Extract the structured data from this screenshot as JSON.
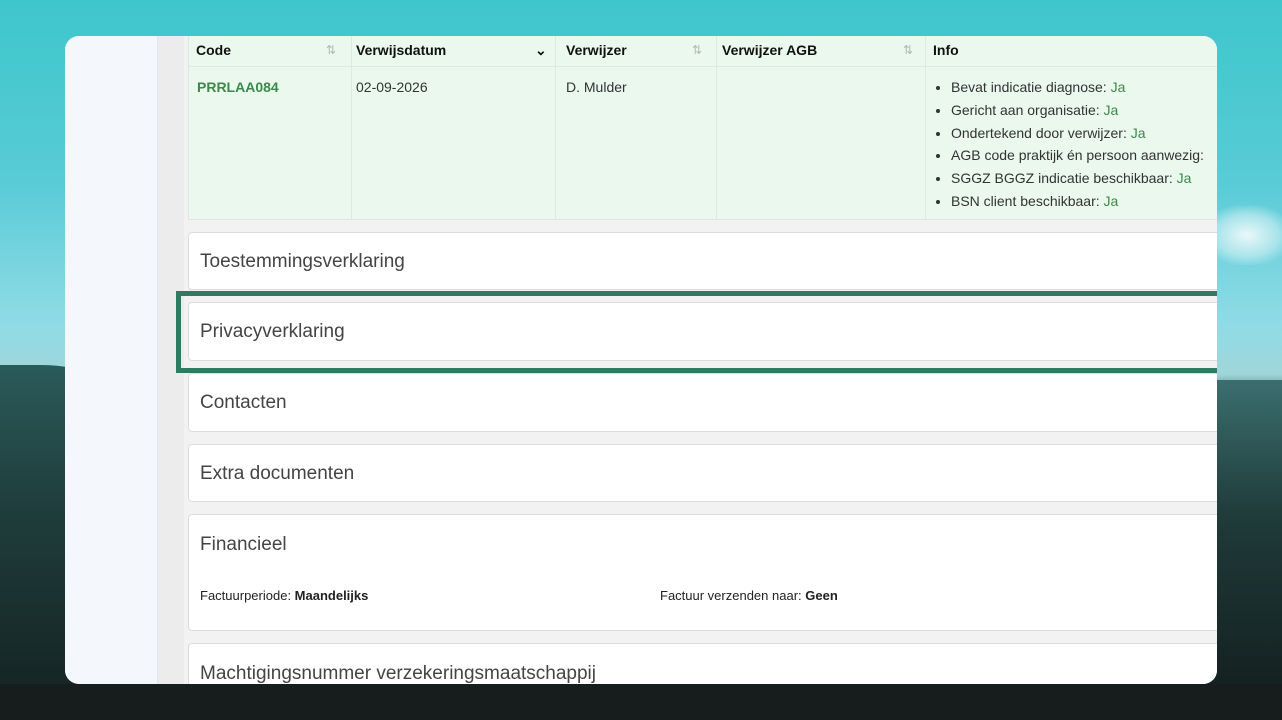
{
  "table": {
    "headers": {
      "code": "Code",
      "date": "Verwijsdatum",
      "referrer": "Verwijzer",
      "referrer_agb": "Verwijzer AGB",
      "info": "Info"
    },
    "row": {
      "code": "PRRLAA084",
      "date": "02-09-2026",
      "referrer": "D. Mulder",
      "referrer_agb": ""
    },
    "info_items": [
      {
        "label": "Bevat indicatie diagnose: ",
        "value": "Ja"
      },
      {
        "label": "Gericht aan organisatie: ",
        "value": "Ja"
      },
      {
        "label": "Ondertekend door verwijzer: ",
        "value": "Ja"
      },
      {
        "label": "AGB code praktijk én persoon aanwezig:",
        "value": ""
      },
      {
        "label": "SGGZ BGGZ indicatie beschikbaar: ",
        "value": "Ja"
      },
      {
        "label": "BSN client beschikbaar: ",
        "value": "Ja"
      }
    ]
  },
  "sections": {
    "consent": "Toestemmingsverklaring",
    "privacy": "Privacyverklaring",
    "contacts": "Contacten",
    "extra_docs": "Extra documenten",
    "financial": "Financieel",
    "authorization": "Machtigingsnummer verzekeringsmaatschappij"
  },
  "financial": {
    "invoice_period_label": "Factuurperiode: ",
    "invoice_period_value": "Maandelijks",
    "send_invoice_label": "Factuur verzenden naar: ",
    "send_invoice_value": "Geen"
  },
  "colors": {
    "accent": "#2f7a60",
    "link_green": "#3c8a4a",
    "row_background": "#eaf8ee"
  },
  "icons": {
    "sort": "sort-icon",
    "sort_active": "chevron-down-icon"
  }
}
